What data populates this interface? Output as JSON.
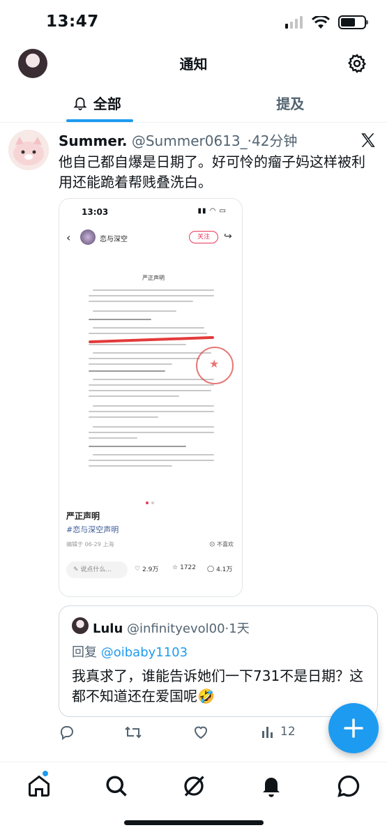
{
  "status_bar": {
    "time": "13:47"
  },
  "header": {
    "title": "通知"
  },
  "tabs": [
    {
      "label": "全部",
      "active": true
    },
    {
      "label": "提及",
      "active": false
    }
  ],
  "notification": {
    "author_name": "Summer.",
    "author_handle": "@Summer0613_",
    "time": "·42分钟",
    "text": "他自己都自爆是日期了。好可怜的瘤子妈这样被利用还能跪着帮贱叠洗白。",
    "screenshot": {
      "time": "13:03",
      "account_name": "恋与深空",
      "follow_label": "关注",
      "doc_title": "严正声明",
      "post_title": "严正声明",
      "hashtag": "#恋与深空声明",
      "edited_meta": "编辑于 06-29 上海",
      "dislike_label": "不喜欢",
      "comment_placeholder": "说点什么...",
      "likes": "2.9万",
      "stars": "1722",
      "comments": "4.1万"
    },
    "quote": {
      "author_name": "Lulu",
      "author_handle": "@infinityevol00",
      "time": "·1天",
      "reply_prefix": "回复",
      "reply_handle": "@oibaby1103",
      "text": "我真求了，谁能告诉她们一下731不是日期？这都不知道还在爱国呢🤣"
    },
    "actions": {
      "views": "12"
    }
  },
  "colors": {
    "accent": "#1d9bf0",
    "text": "#0f1419",
    "muted": "#536471",
    "red_brand": "#e8365d"
  }
}
